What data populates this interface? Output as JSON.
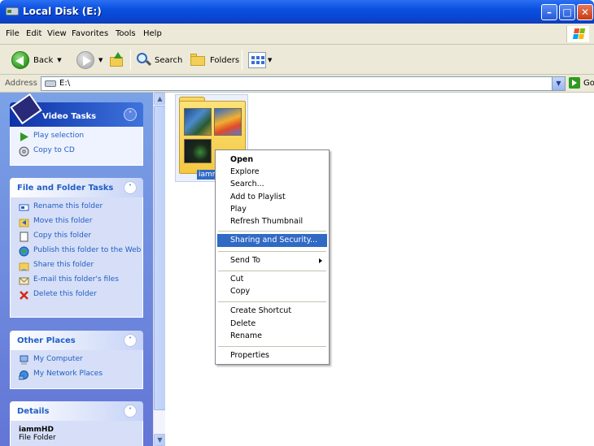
{
  "window": {
    "title": "Local Disk (E:)",
    "buttons": {
      "minimize": "–",
      "maximize": "□",
      "close": "✕"
    }
  },
  "menu": [
    "File",
    "Edit",
    "View",
    "Favorites",
    "Tools",
    "Help"
  ],
  "toolbar": {
    "back_label": "Back",
    "search_label": "Search",
    "folders_label": "Folders"
  },
  "address": {
    "label": "Address",
    "value": "E:\\",
    "go_label": "Go"
  },
  "taskpane": {
    "video_tasks": {
      "title": "Video Tasks",
      "items": [
        "Play selection",
        "Copy to CD"
      ]
    },
    "file_folder_tasks": {
      "title": "File and Folder Tasks",
      "items": [
        "Rename this folder",
        "Move this folder",
        "Copy this folder",
        "Publish this folder to the Web",
        "Share this folder",
        "E-mail this folder's files",
        "Delete this folder"
      ]
    },
    "other_places": {
      "title": "Other Places",
      "items": [
        "My Computer",
        "My Network Places"
      ]
    },
    "details": {
      "title": "Details",
      "name": "iammHD",
      "type": "File Folder"
    }
  },
  "main": {
    "folder_label": "iamm"
  },
  "context_menu": {
    "items": [
      "Open",
      "Explore",
      "Search...",
      "Add to Playlist",
      "Play",
      "Refresh Thumbnail",
      "Sharing and Security...",
      "Send To",
      "Cut",
      "Copy",
      "Create Shortcut",
      "Delete",
      "Rename",
      "Properties"
    ],
    "highlighted": "Sharing and Security..."
  },
  "colors": {
    "titlebar": "#0a50e0",
    "selection": "#316ac5",
    "taskpane_link": "#215dc6"
  }
}
